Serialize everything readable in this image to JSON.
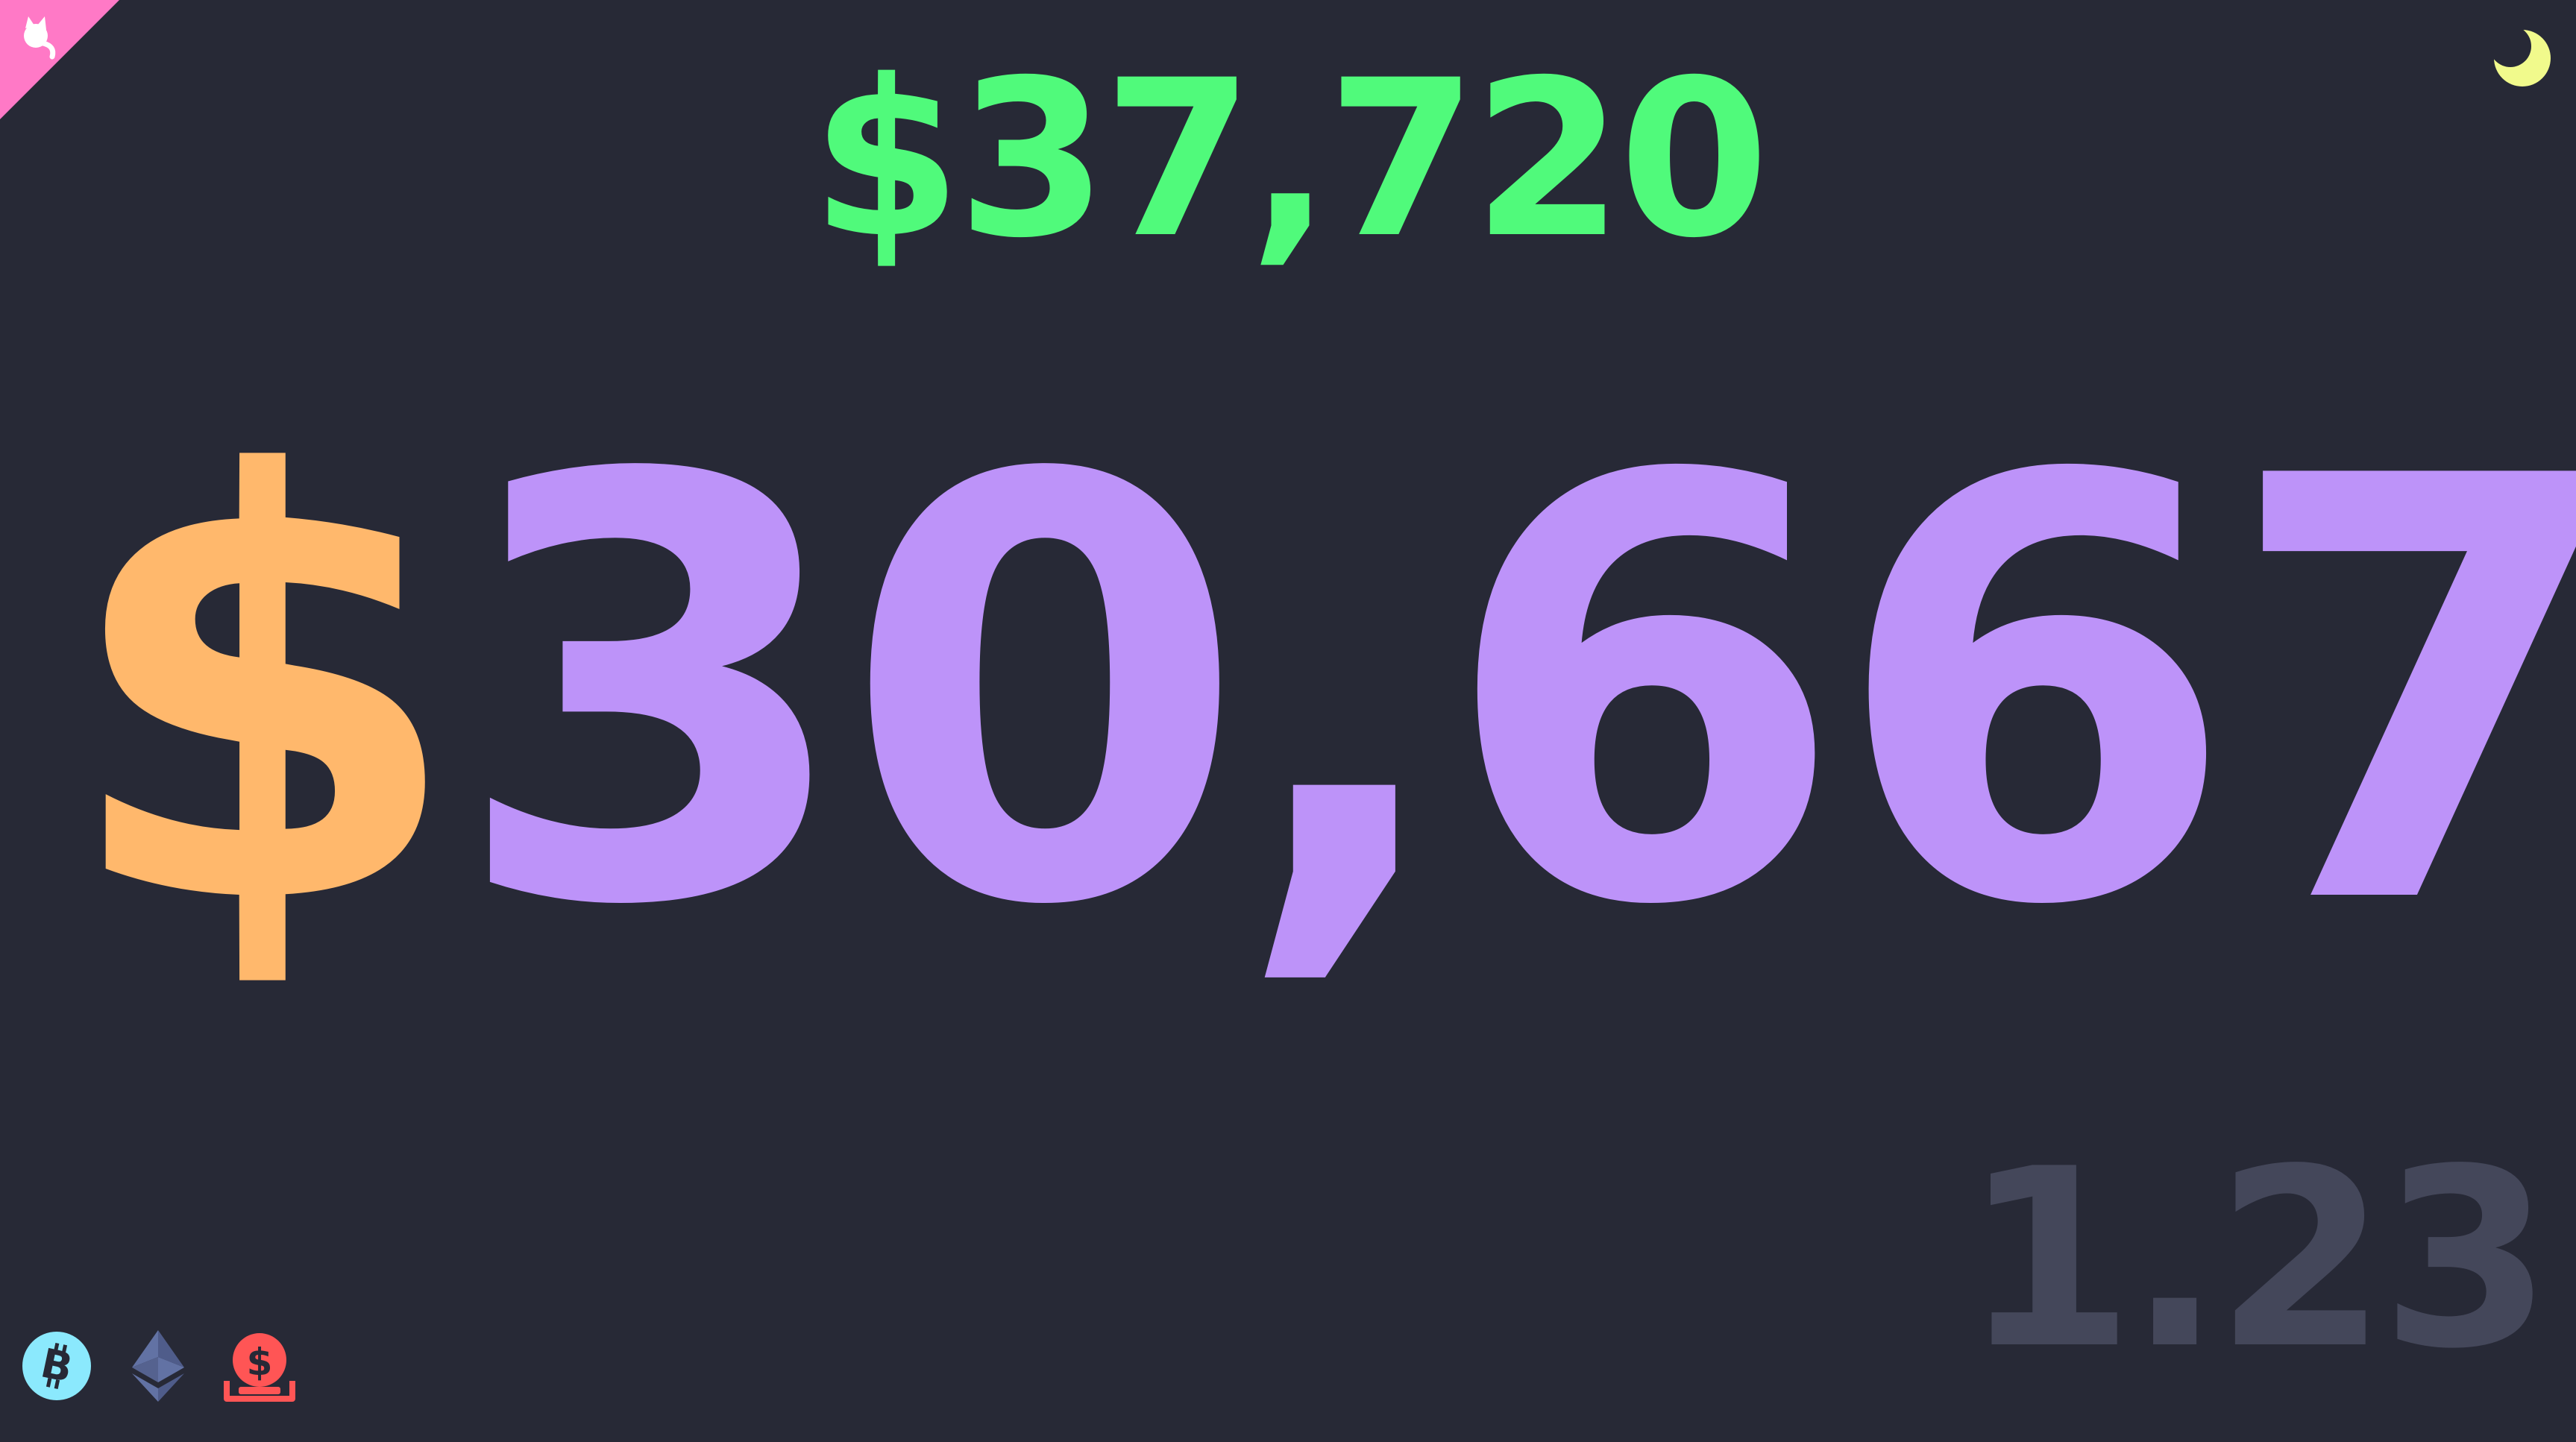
{
  "secondary_price": "$37,720",
  "main_price": {
    "currency": "$",
    "amount": "30,667"
  },
  "ratio": "1.23",
  "icons": {
    "corner": "github-cat-icon",
    "theme": "moon-icon",
    "coins": [
      "bitcoin-icon",
      "ethereum-icon",
      "usd-coin-icon"
    ]
  },
  "colors": {
    "background": "#272936",
    "secondary_price": "#50fa7b",
    "currency": "#ffb86c",
    "amount": "#bd93f9",
    "ratio": "#44475a",
    "ribbon": "#ff79c6",
    "moon": "#f1fa8c",
    "bitcoin": "#8be9fd",
    "ethereum": "#6272a4",
    "usd": "#ff5555"
  }
}
